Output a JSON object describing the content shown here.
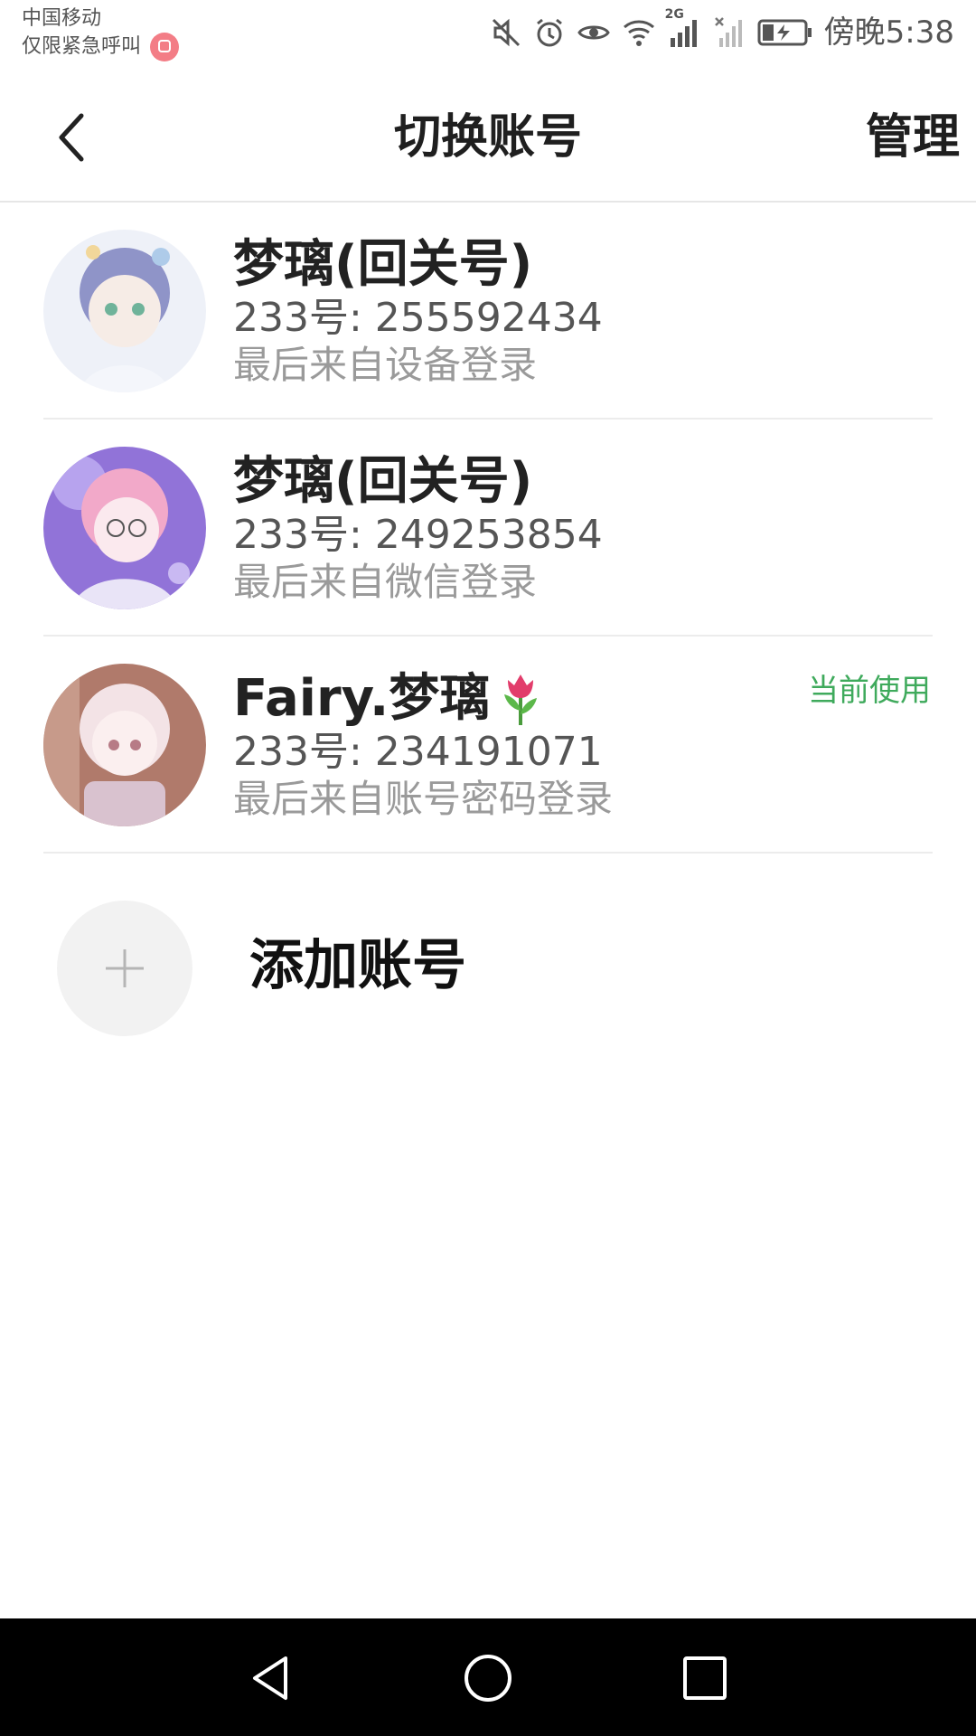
{
  "status_bar": {
    "carrier": "中国移动",
    "emergency": "仅限紧急呼叫",
    "network_type": "2G",
    "time": "傍晚5:38"
  },
  "header": {
    "title": "切换账号",
    "manage_label": "管理"
  },
  "accounts": [
    {
      "name": "梦璃(回关号)",
      "id_text": "233号: 255592434",
      "source": "最后来自设备登录",
      "current": false,
      "avatar_colors": [
        "#dfe6f4",
        "#8f94c8",
        "#f6e7c8"
      ]
    },
    {
      "name": "梦璃(回关号)",
      "id_text": "233号: 249253854",
      "source": "最后来自微信登录",
      "current": false,
      "avatar_colors": [
        "#8e6fd6",
        "#f2a9c9",
        "#e9e4f7"
      ]
    },
    {
      "name": "Fairy.梦璃",
      "id_text": "233号: 234191071",
      "source": "最后来自账号密码登录",
      "current": true,
      "current_label": "当前使用",
      "avatar_colors": [
        "#b07a6b",
        "#f3d8dd",
        "#d9c2cf"
      ]
    }
  ],
  "add_account": {
    "label": "添加账号"
  },
  "colors": {
    "accent_green": "#3faa5c",
    "divider": "#ececec"
  }
}
